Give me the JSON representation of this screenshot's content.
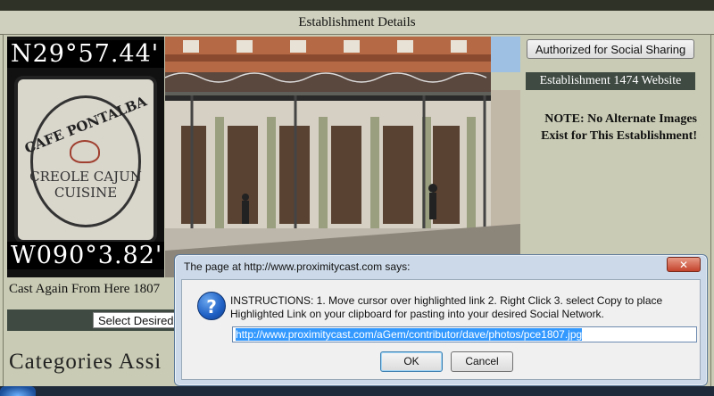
{
  "header": {
    "title": "Establishment Details"
  },
  "left": {
    "latitude": "N29°57.44'",
    "longitude": "W090°3.82'",
    "sign_name": "CAFE PONTALBA",
    "sign_cuisine_line1": "CREOLE CAJUN",
    "sign_cuisine_line2": "CUISINE",
    "cast_again": "Cast Again From Here 1807",
    "select_label": "Select Desired",
    "categories_heading": "Categories Assi"
  },
  "right": {
    "authorized_button": "Authorized for Social Sharing",
    "website_link": "Establishment 1474 Website",
    "note": "NOTE: No Alternate Images Exist for This Establishment!"
  },
  "dialog": {
    "title": "The page at http://www.proximitycast.com says:",
    "close_symbol": "✕",
    "info_symbol": "?",
    "instructions": "INSTRUCTIONS: 1. Move cursor over highlighted link 2. Right Click 3. select Copy to place Highlighted Link on your clipboard for pasting into your desired Social Network.",
    "url_value": "http://www.proximitycast.com/aGem/contributor/dave/photos/pce1807.jpg",
    "ok_label": "OK",
    "cancel_label": "Cancel"
  },
  "colors": {
    "page_bg": "#c9cbb4",
    "dark_bar": "#3f4a42",
    "dialog_frame": "#ccd9e8",
    "close_red": "#c4432c",
    "url_selection": "#3399ff"
  }
}
